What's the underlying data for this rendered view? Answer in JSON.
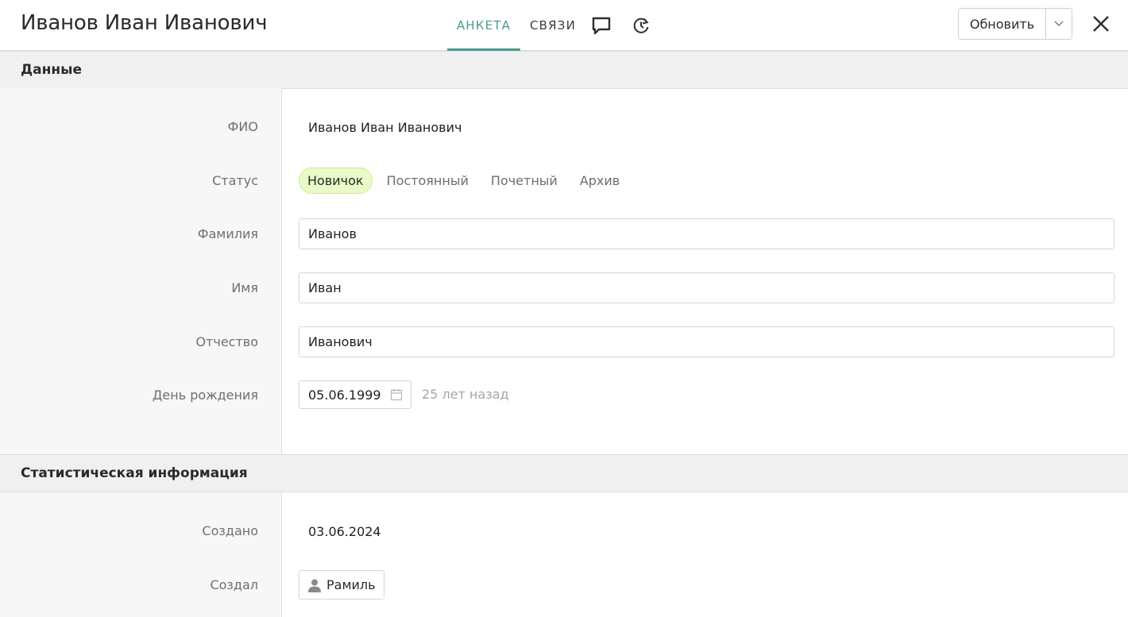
{
  "header": {
    "title": "Иванов Иван Иванович",
    "tabs": [
      {
        "label": "АНКЕТА",
        "active": true
      },
      {
        "label": "СВЯЗИ",
        "active": false
      }
    ],
    "icons": [
      "chat-icon",
      "history-icon"
    ],
    "update_label": "Обновить"
  },
  "sections": {
    "data": {
      "title": "Данные",
      "fio_label": "ФИО",
      "fio_value": "Иванов Иван Иванович",
      "status_label": "Статус",
      "status_options": [
        "Новичок",
        "Постоянный",
        "Почетный",
        "Архив"
      ],
      "status_selected": "Новичок",
      "lastname_label": "Фамилия",
      "lastname_value": "Иванов",
      "firstname_label": "Имя",
      "firstname_value": "Иван",
      "patronymic_label": "Отчество",
      "patronymic_value": "Иванович",
      "birthday_label": "День рождения",
      "birthday_value": "05.06.1999",
      "birthday_age": "25 лет назад"
    },
    "stats": {
      "title": "Статистическая информация",
      "created_label": "Создано",
      "created_value": "03.06.2024",
      "creator_label": "Создал",
      "creator_value": "Рамиль"
    }
  },
  "colors": {
    "accent": "#4a9a8c",
    "status_active_bg": "#eafbc8",
    "section_bg": "#f0f0f0"
  }
}
